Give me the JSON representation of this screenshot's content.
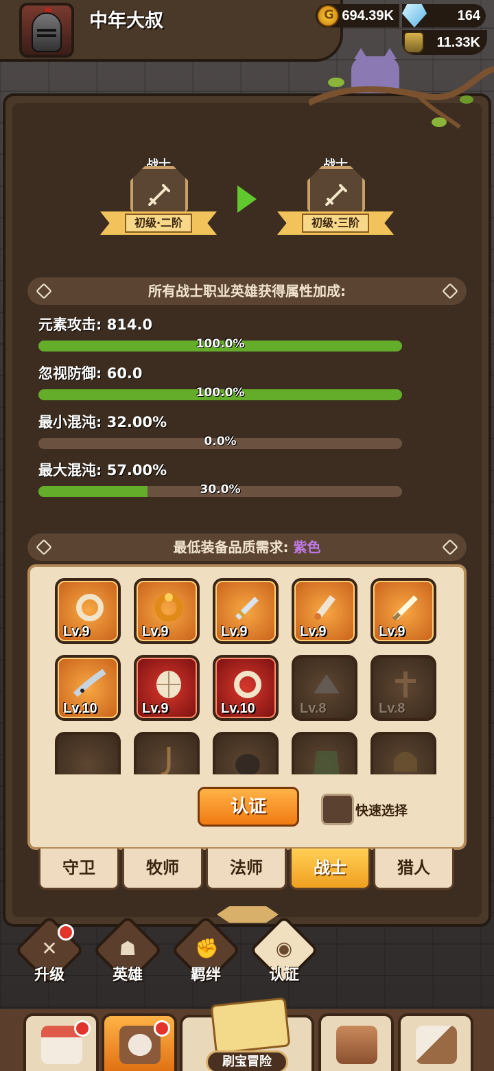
{
  "header": {
    "player_name": "中年大叔",
    "gold": "694.39K",
    "gems": "164",
    "potions": "11.33K"
  },
  "upgrade": {
    "class_from": "战士",
    "tier_from": "初级·二阶",
    "class_to": "战士",
    "tier_to": "初级·三阶"
  },
  "bonus": {
    "title": "所有战士职业英雄获得属性加成:",
    "stats": [
      {
        "label": "元素攻击: 814.0",
        "percent": "100.0%",
        "progress": 1.0
      },
      {
        "label": "忽视防御: 60.0",
        "percent": "100.0%",
        "progress": 1.0
      },
      {
        "label": "最小混沌: 32.00%",
        "percent": "0.0%",
        "progress": 0.0
      },
      {
        "label": "最大混沌: 57.00%",
        "percent": "30.0%",
        "progress": 0.3
      }
    ]
  },
  "requirement": {
    "label": "最低装备品质需求:",
    "quality": "紫色"
  },
  "equipment": [
    {
      "level": "Lv.9",
      "icon": "rope-ring-icon",
      "rarity": "orange"
    },
    {
      "level": "Lv.9",
      "icon": "amber-ring-icon",
      "rarity": "orange"
    },
    {
      "level": "Lv.9",
      "icon": "sword-icon",
      "rarity": "orange"
    },
    {
      "level": "Lv.9",
      "icon": "dagger-icon",
      "rarity": "orange"
    },
    {
      "level": "Lv.9",
      "icon": "light-saber-icon",
      "rarity": "orange"
    },
    {
      "level": "Lv.10",
      "icon": "swordfish-icon",
      "rarity": "orange"
    },
    {
      "level": "Lv.9",
      "icon": "turtle-shell-icon",
      "rarity": "red"
    },
    {
      "level": "Lv.10",
      "icon": "rope-ring-icon",
      "rarity": "red"
    },
    {
      "level": "Lv.8",
      "icon": "hat-icon",
      "rarity": "dark"
    },
    {
      "level": "Lv.8",
      "icon": "cross-icon",
      "rarity": "dark"
    },
    {
      "level": "",
      "icon": "empty-icon",
      "rarity": "dark"
    },
    {
      "level": "",
      "icon": "rope-icon",
      "rarity": "dark"
    },
    {
      "level": "",
      "icon": "fur-icon",
      "rarity": "dark"
    },
    {
      "level": "",
      "icon": "camo-armor-icon",
      "rarity": "dark"
    },
    {
      "level": "",
      "icon": "helmet-icon",
      "rarity": "dark"
    }
  ],
  "actions": {
    "certify": "认证",
    "quick_select": "快速选择"
  },
  "class_tabs": [
    "守卫",
    "牧师",
    "法师",
    "战士",
    "猎人"
  ],
  "active_class_tab": 3,
  "sub_nav": [
    {
      "label": "升级",
      "icon": "swords-icon",
      "badge": true
    },
    {
      "label": "英雄",
      "icon": "hero-icon",
      "badge": false
    },
    {
      "label": "羁绊",
      "icon": "fist-icon",
      "badge": false
    },
    {
      "label": "认证",
      "icon": "eye-icon",
      "badge": false
    }
  ],
  "bottom_nav": {
    "adventure": "刷宝冒险"
  },
  "colors": {
    "progress_fill": "#64ad2a",
    "quality_purple": "#c07ae8",
    "active_tab": "#f0a020"
  }
}
